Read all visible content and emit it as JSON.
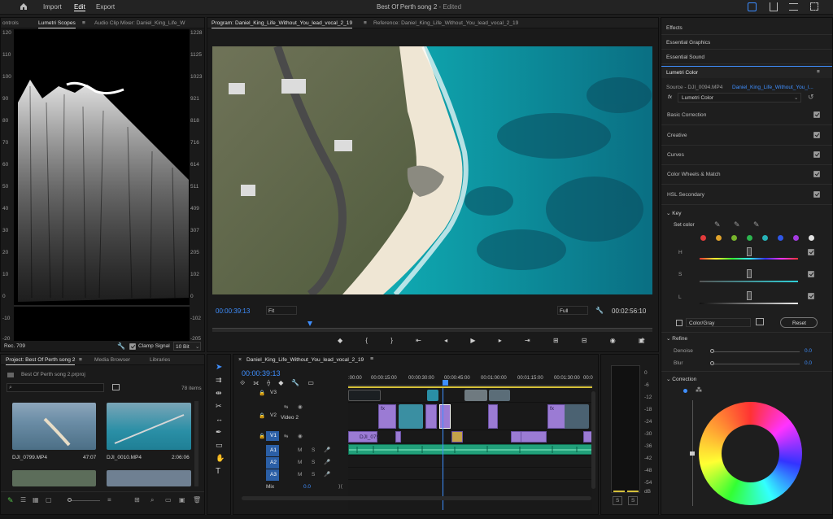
{
  "topbar": {
    "import": "Import",
    "edit": "Edit",
    "export": "Export",
    "title": "Best Of Perth song 2",
    "title_status": " - Edited"
  },
  "scopes": {
    "tabs": [
      "ontrols",
      "Lumetri Scopes",
      "Audio Clip Mixer: Daniel_King_Life_W"
    ],
    "left_scale": [
      "120",
      "110",
      "100",
      "90",
      "80",
      "70",
      "60",
      "50",
      "40",
      "30",
      "20",
      "10",
      "0",
      "-10",
      "-20"
    ],
    "right_scale": [
      "1228",
      "1125",
      "1023",
      "921",
      "818",
      "716",
      "614",
      "511",
      "409",
      "307",
      "205",
      "102",
      "0",
      "-102",
      "-205"
    ],
    "rec": "Rec. 709",
    "clamp": "Clamp Signal",
    "bits": "10 Bit"
  },
  "program": {
    "tabs": [
      "Program: Daniel_King_Life_Without_You_lead_vocal_2_19",
      "Reference: Daniel_King_Life_Without_You_lead_vocal_2_19"
    ],
    "timecode": "00:00:39:13",
    "fit": "Fit",
    "full": "Full",
    "duration": "00:02:56:10"
  },
  "lumetri_side": {
    "effects": "Effects",
    "essential_graphics": "Essential Graphics",
    "essential_sound": "Essential Sound",
    "title": "Lumetri Color",
    "source": "Source - DJI_0094.MP4",
    "clip": "Daniel_King_Life_Without_You_l...",
    "fx": "fx",
    "effect": "Lumetri Color",
    "sections": [
      "Basic Correction",
      "Creative",
      "Curves",
      "Color Wheels & Match",
      "HSL Secondary"
    ],
    "key": "Key",
    "set_color": "Set color",
    "h": "H",
    "s": "S",
    "l": "L",
    "color_gray": "Color/Gray",
    "reset": "Reset",
    "refine": "Refine",
    "denoise": "Denoise",
    "denoise_val": "0.0",
    "blur": "Blur",
    "blur_val": "0.0",
    "correction": "Correction",
    "swatch_colors": [
      "#e23b3b",
      "#e0a22b",
      "#78b52c",
      "#2cb54f",
      "#27b3b8",
      "#2f57e8",
      "#a33be0",
      "#e2e2e2"
    ]
  },
  "project": {
    "tabs": [
      "Project: Best Of Perth song 2",
      "Media Browser",
      "Libraries"
    ],
    "file": "Best Of Perth song 2.prproj",
    "items": "78 items",
    "media": [
      {
        "name": "DJI_0799.MP4",
        "dur": "47:07"
      },
      {
        "name": "DJI_0010.MP4",
        "dur": "2:06:06"
      }
    ]
  },
  "timeline": {
    "tab": "Daniel_King_Life_Without_You_lead_vocal_2_19",
    "timecode": "00:00:39:13",
    "ruler": [
      ":00:00",
      "00:00:15:00",
      "00:00:30:00",
      "00:00:45:00",
      "00:01:00:00",
      "00:01:15:00",
      "00:01:30:00",
      "00:0"
    ],
    "tracks": {
      "v3": "V3",
      "v2": "V2",
      "v2_name": "Video 2",
      "v1": "V1",
      "a1": "A1",
      "a2": "A2",
      "a3": "A3",
      "mix": "Mix",
      "mix_val": "0.0"
    },
    "clip_labels": {
      "dji": "DJI_079",
      "fx": "fx"
    }
  },
  "meter": {
    "scale": [
      "0",
      "-6",
      "-12",
      "-18",
      "-24",
      "-30",
      "-36",
      "-42",
      "-48",
      "-54",
      "dB"
    ],
    "s": "S"
  }
}
